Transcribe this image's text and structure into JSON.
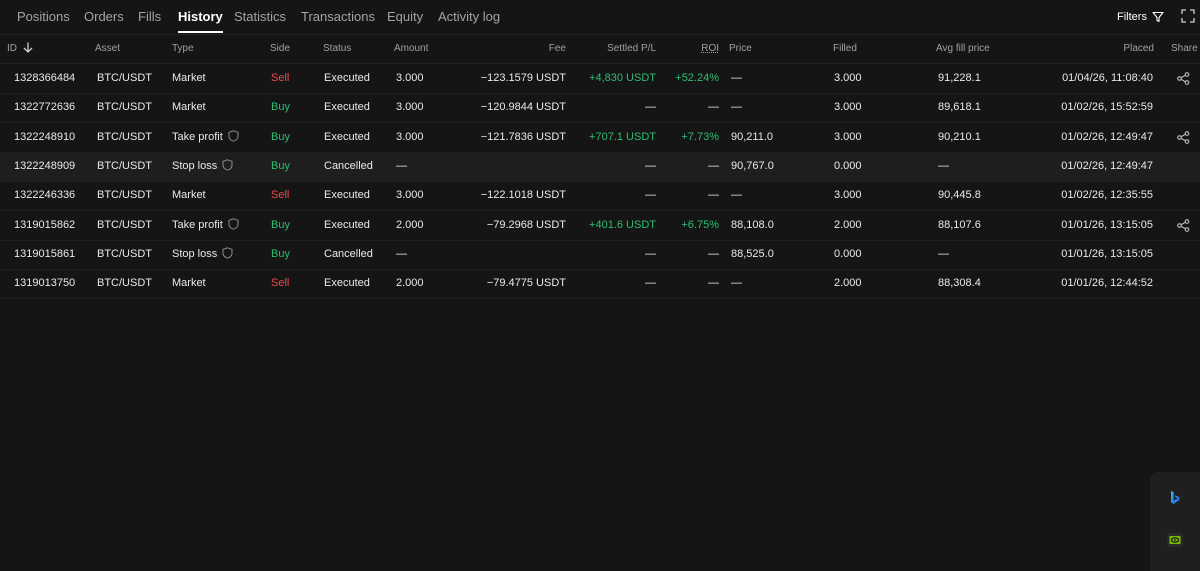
{
  "tabs": [
    "Positions",
    "Orders",
    "Fills",
    "History",
    "Statistics",
    "Transactions",
    "Equity",
    "Activity log"
  ],
  "active_tab": "History",
  "filters_label": "Filters",
  "columns": {
    "id": "ID",
    "asset": "Asset",
    "type": "Type",
    "side": "Side",
    "status": "Status",
    "amount": "Amount",
    "fee": "Fee",
    "settled_pl": "Settled P/L",
    "roi": "ROI",
    "price": "Price",
    "filled": "Filled",
    "avg_fill_price": "Avg fill price",
    "placed": "Placed",
    "share": "Share"
  },
  "rows": [
    {
      "id": "1328366484",
      "asset": "BTC/USDT",
      "type": "Market",
      "shield": false,
      "side": "Sell",
      "status": "Executed",
      "amount": "3.000",
      "fee": "−123.1579 USDT",
      "settled_pl": "+4,830 USDT",
      "roi": "+52.24%",
      "price": "—",
      "filled": "3.000",
      "avg_fill_price": "91,228.1",
      "placed": "01/04/26, 11:08:40",
      "share": true
    },
    {
      "id": "1322772636",
      "asset": "BTC/USDT",
      "type": "Market",
      "shield": false,
      "side": "Buy",
      "status": "Executed",
      "amount": "3.000",
      "fee": "−120.9844 USDT",
      "settled_pl": "—",
      "roi": "—",
      "price": "—",
      "filled": "3.000",
      "avg_fill_price": "89,618.1",
      "placed": "01/02/26, 15:52:59",
      "share": false
    },
    {
      "id": "1322248910",
      "asset": "BTC/USDT",
      "type": "Take profit",
      "shield": true,
      "side": "Buy",
      "status": "Executed",
      "amount": "3.000",
      "fee": "−121.7836 USDT",
      "settled_pl": "+707.1 USDT",
      "roi": "+7.73%",
      "price": "90,211.0",
      "filled": "3.000",
      "avg_fill_price": "90,210.1",
      "placed": "01/02/26, 12:49:47",
      "share": true
    },
    {
      "id": "1322248909",
      "asset": "BTC/USDT",
      "type": "Stop loss",
      "shield": true,
      "side": "Buy",
      "status": "Cancelled",
      "amount": "—",
      "fee": "",
      "settled_pl": "—",
      "roi": "—",
      "price": "90,767.0",
      "filled": "0.000",
      "avg_fill_price": "—",
      "placed": "01/02/26, 12:49:47",
      "share": false
    },
    {
      "id": "1322246336",
      "asset": "BTC/USDT",
      "type": "Market",
      "shield": false,
      "side": "Sell",
      "status": "Executed",
      "amount": "3.000",
      "fee": "−122.1018 USDT",
      "settled_pl": "—",
      "roi": "—",
      "price": "—",
      "filled": "3.000",
      "avg_fill_price": "90,445.8",
      "placed": "01/02/26, 12:35:55",
      "share": false
    },
    {
      "id": "1319015862",
      "asset": "BTC/USDT",
      "type": "Take profit",
      "shield": true,
      "side": "Buy",
      "status": "Executed",
      "amount": "2.000",
      "fee": "−79.2968 USDT",
      "settled_pl": "+401.6 USDT",
      "roi": "+6.75%",
      "price": "88,108.0",
      "filled": "2.000",
      "avg_fill_price": "88,107.6",
      "placed": "01/01/26, 13:15:05",
      "share": true
    },
    {
      "id": "1319015861",
      "asset": "BTC/USDT",
      "type": "Stop loss",
      "shield": true,
      "side": "Buy",
      "status": "Cancelled",
      "amount": "—",
      "fee": "",
      "settled_pl": "—",
      "roi": "—",
      "price": "88,525.0",
      "filled": "0.000",
      "avg_fill_price": "—",
      "placed": "01/01/26, 13:15:05",
      "share": false
    },
    {
      "id": "1319013750",
      "asset": "BTC/USDT",
      "type": "Market",
      "shield": false,
      "side": "Sell",
      "status": "Executed",
      "amount": "2.000",
      "fee": "−79.4775 USDT",
      "settled_pl": "—",
      "roi": "—",
      "price": "—",
      "filled": "2.000",
      "avg_fill_price": "88,308.4",
      "placed": "01/01/26, 12:44:52",
      "share": false
    }
  ],
  "colors": {
    "buy": "#2fbd72",
    "sell": "#f0484f",
    "background": "#151515"
  },
  "icons": {
    "id_sort": "arrow-down-icon",
    "filters": "funnel-icon",
    "expand": "expand-icon",
    "share": "share-icon",
    "type_badge": "shield-icon",
    "dock_top": "bing-icon",
    "dock_bottom": "nvidia-icon"
  }
}
